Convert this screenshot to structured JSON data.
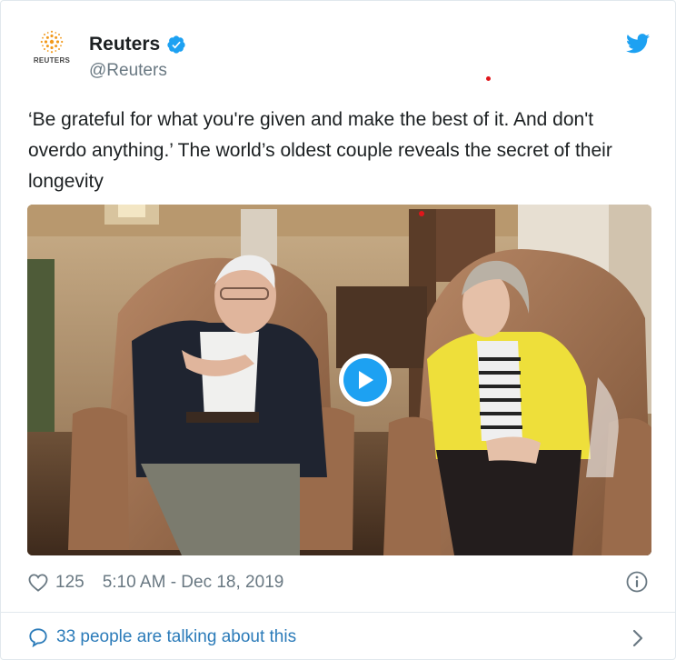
{
  "account": {
    "display_name": "Reuters",
    "handle": "@Reuters",
    "logo_text": "REUTERS",
    "verified_icon": "verified-badge-icon",
    "brand_icon": "twitter-bird-icon"
  },
  "tweet": {
    "text": "‘Be grateful for what you're given and make the best of it. And don't overdo anything.’ The world’s oldest couple reveals the secret of their longevity"
  },
  "media": {
    "type": "video",
    "play_icon": "play-icon"
  },
  "meta": {
    "like_icon": "heart-icon",
    "like_count": "125",
    "timestamp": "5:10 AM - Dec 18, 2019",
    "info_icon": "info-icon"
  },
  "footer": {
    "talking_icon": "speech-bubble-icon",
    "talking_text": "33 people are talking about this",
    "chevron_icon": "chevron-right-icon"
  },
  "colors": {
    "twitter_blue": "#1da1f2",
    "link_blue": "#2b7bb9",
    "secondary_text": "#697882",
    "red_dot": "#e0161b"
  }
}
